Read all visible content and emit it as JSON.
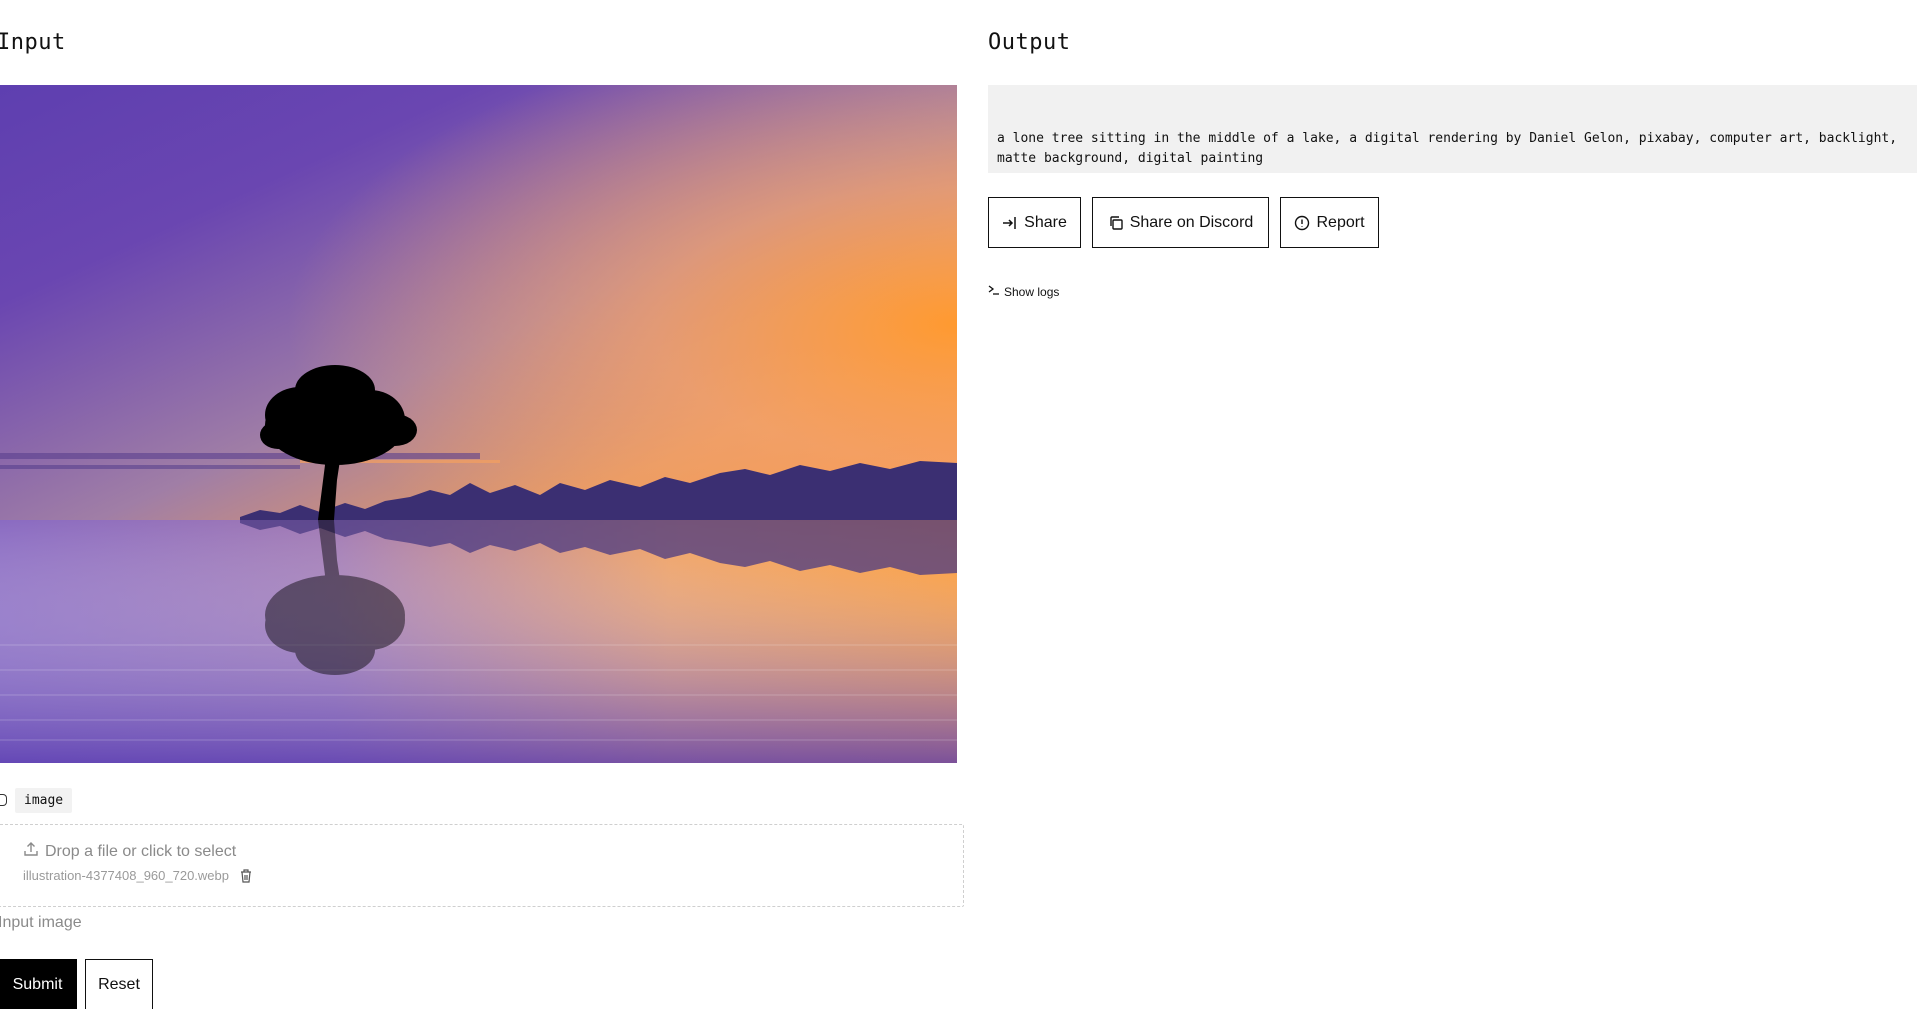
{
  "input": {
    "title": "Input",
    "image_alt": "illustration of a lone tree in a lake at sunset",
    "param_name": "image",
    "dropzone_hint": "Drop a file or click to select",
    "file_name": "illustration-4377408_960_720.webp",
    "caption": "Input image",
    "submit_label": "Submit",
    "reset_label": "Reset"
  },
  "output": {
    "title": "Output",
    "text": "a lone tree sitting in the middle of a lake, a digital rendering by Daniel Gelon, pixabay, computer art, backlight, matte background, digital painting",
    "share_label": "Share",
    "discord_label": "Share on Discord",
    "report_label": "Report",
    "show_logs_label": "Show logs"
  },
  "icons": {
    "upload": "upload-icon",
    "trash": "trash-icon",
    "share": "share-icon",
    "copy": "copy-icon",
    "report": "alert-circle-icon",
    "terminal": "terminal-icon",
    "file": "file-icon"
  }
}
